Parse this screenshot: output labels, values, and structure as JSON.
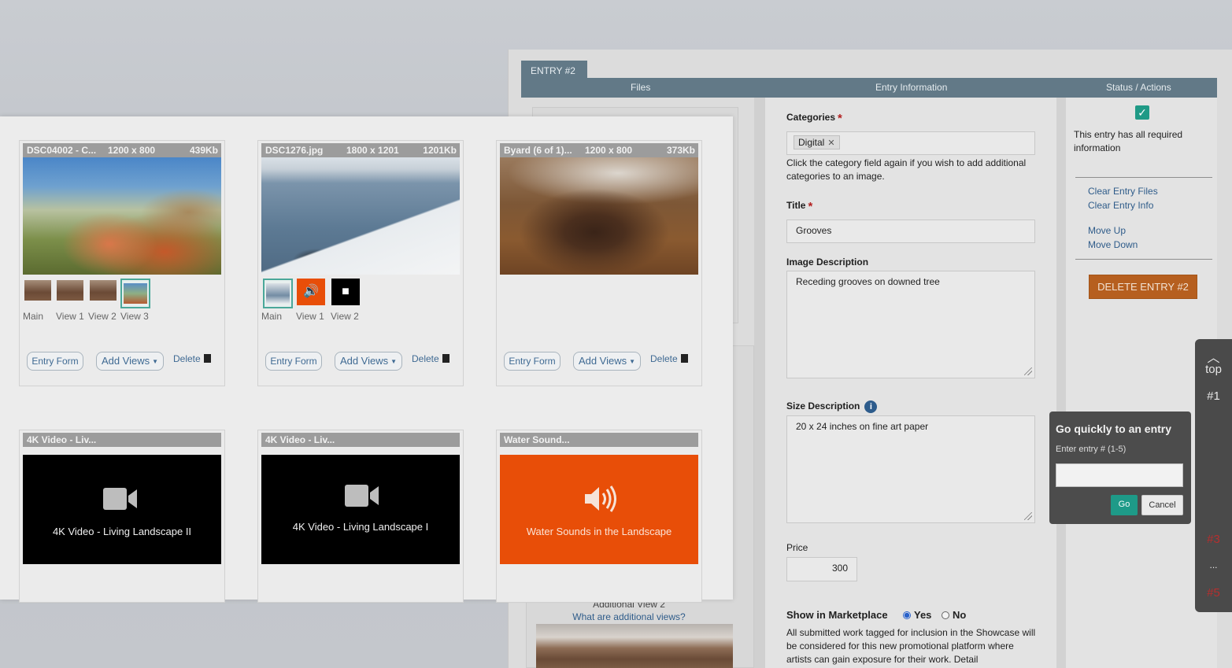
{
  "entry": {
    "tab": "ENTRY #2",
    "columns": [
      "Files",
      "Entry Information",
      "Status / Actions"
    ],
    "categories_label": "Categories",
    "categories_chip": "Digital",
    "categories_help": "Click the category field again if you wish to add additional categories to an image.",
    "title_label": "Title",
    "title_value": "Grooves",
    "desc_label": "Image Description",
    "desc_value": "Receding grooves on downed tree",
    "size_label": "Size Description",
    "size_value": "20 x 24 inches on fine art paper",
    "price_label": "Price",
    "price_value": "300",
    "market_label": "Show in Marketplace",
    "market_yes": "Yes",
    "market_no": "No",
    "market_help": "All submitted work tagged for inclusion in the Showcase will be considered for this new promotional platform where artists can gain exposure for their work. Detail",
    "addl_view": "Additional View 2",
    "addl_link": "What are additional views?",
    "status_text": "This entry has all required information",
    "links": [
      "Clear Entry Files",
      "Clear Entry Info",
      "Move Up",
      "Move Down"
    ],
    "delete_button": "DELETE ENTRY #2"
  },
  "gallery": {
    "cards": [
      {
        "name": "DSC04002 - C...",
        "dims": "1200 x 800",
        "size": "439Kb",
        "views": [
          "Main",
          "View 1",
          "View 2",
          "View 3"
        ]
      },
      {
        "name": "DSC1276.jpg",
        "dims": "1800 x 1201",
        "size": "1201Kb",
        "views": [
          "Main",
          "View 1",
          "View 2"
        ]
      },
      {
        "name": "Byard (6 of 1)...",
        "dims": "1200 x 800",
        "size": "373Kb",
        "views": []
      }
    ],
    "media": [
      {
        "head": "4K Video - Liv...",
        "label": "4K Video - Living Landscape II",
        "kind": "video"
      },
      {
        "head": "4K Video - Liv...",
        "label": "4K Video - Living Landscape I",
        "kind": "video"
      },
      {
        "head": "Water Sound...",
        "label": "Water Sounds in the Landscape",
        "kind": "audio"
      }
    ],
    "entry_form": "Entry Form",
    "add_views": "Add Views",
    "delete": "Delete"
  },
  "nav": {
    "top": "top",
    "items": [
      "#1",
      "#3",
      "...",
      "#5"
    ]
  },
  "quick": {
    "title": "Go quickly to an entry",
    "sub": "Enter entry # (1-5)",
    "input_value": "",
    "go": "Go",
    "cancel": "Cancel"
  },
  "colors": {
    "accent": "#1e9a88",
    "header": "#627987",
    "danger": "#b65f1f",
    "audio": "#e84e08"
  }
}
